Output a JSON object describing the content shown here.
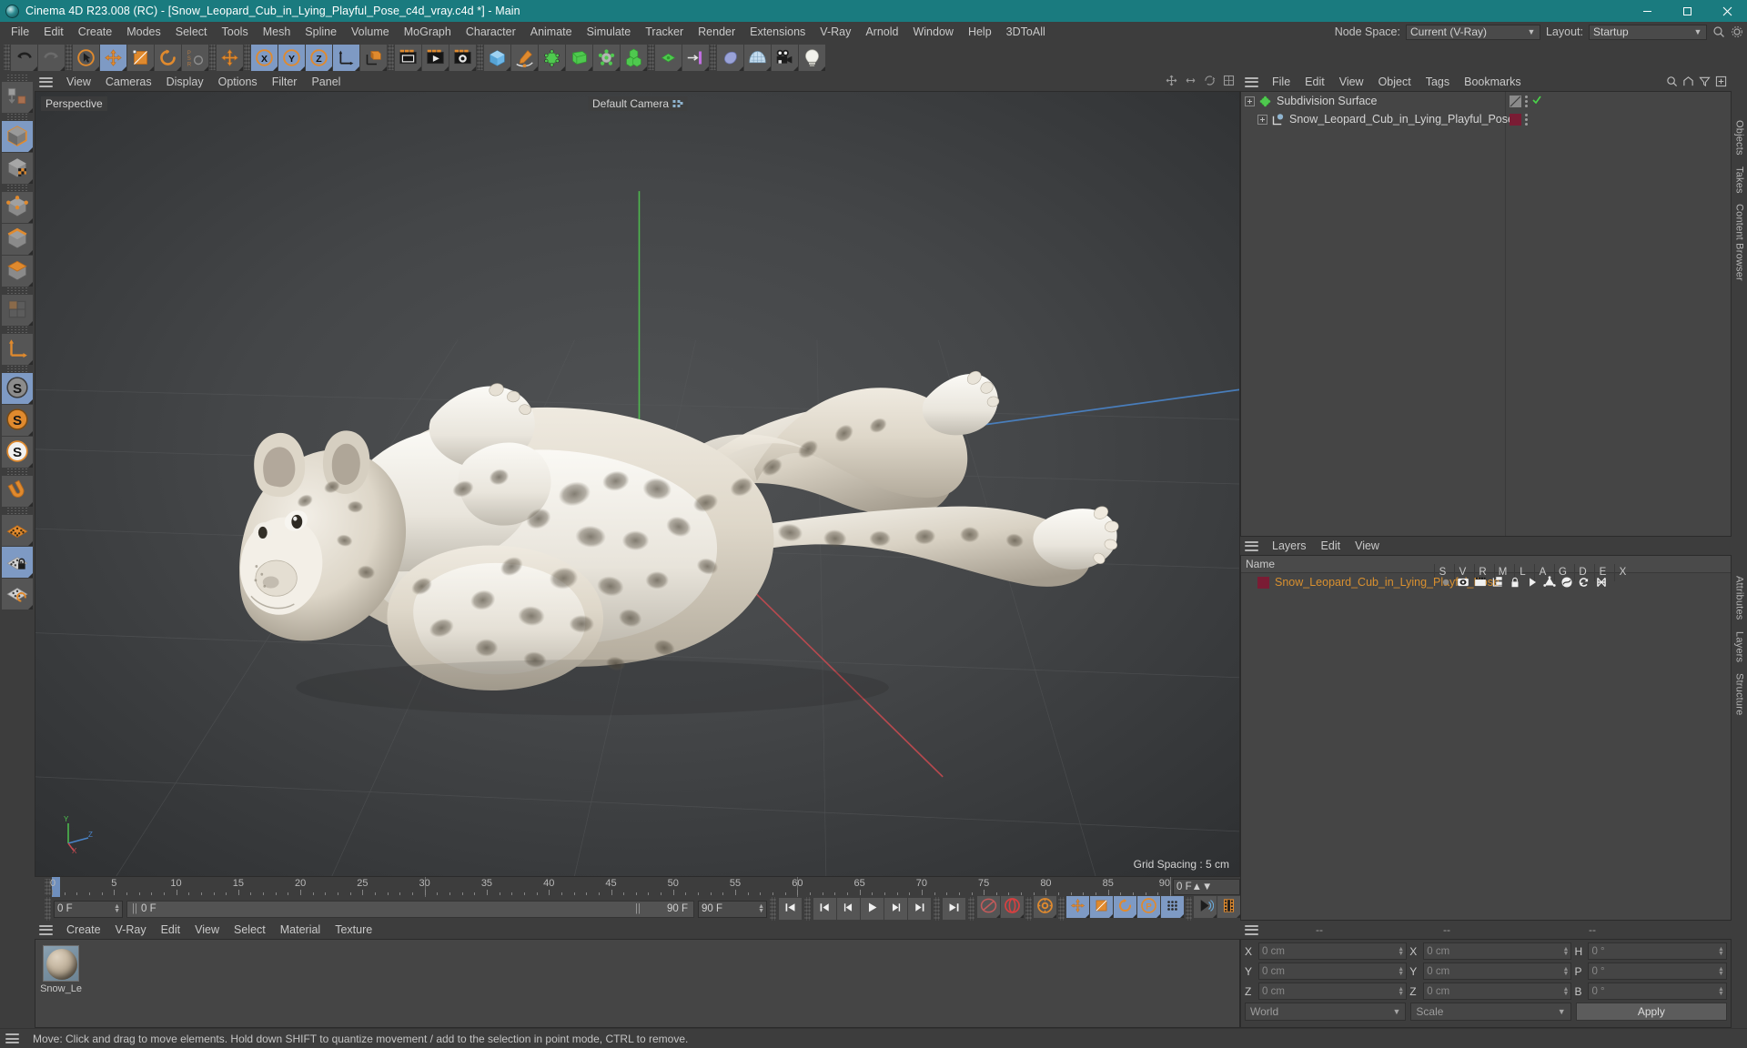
{
  "window": {
    "title": "Cinema 4D R23.008 (RC) - [Snow_Leopard_Cub_in_Lying_Playful_Pose_c4d_vray.c4d *] - Main",
    "minimize_label": "Minimize",
    "maximize_label": "Maximize",
    "close_label": "Close"
  },
  "menubar": {
    "items": [
      "File",
      "Edit",
      "Create",
      "Modes",
      "Select",
      "Tools",
      "Mesh",
      "Spline",
      "Volume",
      "MoGraph",
      "Character",
      "Animate",
      "Simulate",
      "Tracker",
      "Render",
      "Extensions",
      "V-Ray",
      "Arnold",
      "Window",
      "Help",
      "3DToAll"
    ],
    "node_space_label": "Node Space:",
    "node_space_value": "Current (V-Ray)",
    "layout_label": "Layout:",
    "layout_value": "Startup",
    "search_icon": "search-icon",
    "settings_icon": "gear-icon"
  },
  "toolbar": {
    "buttons": [
      {
        "name": "undo",
        "icon": "undo-icon",
        "selected": false
      },
      {
        "name": "redo",
        "icon": "redo-icon",
        "selected": false
      },
      {
        "name": "live-selection",
        "icon": "cursor-circle-icon",
        "selected": false
      },
      {
        "name": "move",
        "icon": "move-arrows-icon",
        "selected": true
      },
      {
        "name": "scale",
        "icon": "scale-box-icon",
        "selected": false
      },
      {
        "name": "rotate",
        "icon": "rotate-circle-icon",
        "selected": false
      },
      {
        "name": "psr-reset",
        "icon": "psr-icon",
        "selected": false
      },
      {
        "name": "move-system",
        "icon": "move-arrows-icon",
        "selected": false
      },
      {
        "name": "lock-x",
        "icon": "axis-x-icon",
        "selected": true
      },
      {
        "name": "lock-y",
        "icon": "axis-y-icon",
        "selected": true
      },
      {
        "name": "lock-z",
        "icon": "axis-z-icon",
        "selected": true
      },
      {
        "name": "world-object-axis",
        "icon": "world-axis-icon",
        "selected": true
      },
      {
        "name": "object-axis",
        "icon": "orange-cube-axis-icon",
        "selected": false
      },
      {
        "name": "render-view",
        "icon": "render-view-icon",
        "selected": false
      },
      {
        "name": "render-to-picture-viewer",
        "icon": "render-picture-icon",
        "selected": false
      },
      {
        "name": "render-settings",
        "icon": "render-settings-icon",
        "selected": false
      },
      {
        "name": "add-cube",
        "icon": "blue-cube-icon",
        "selected": false
      },
      {
        "name": "add-spline",
        "icon": "pen-spline-icon",
        "selected": false
      },
      {
        "name": "add-generator",
        "icon": "green-nurbs-icon",
        "selected": false
      },
      {
        "name": "add-deformer",
        "icon": "green-bend-icon",
        "selected": false
      },
      {
        "name": "add-field",
        "icon": "green-field-icon",
        "selected": false
      },
      {
        "name": "add-array",
        "icon": "green-cubes-icon",
        "selected": false
      },
      {
        "name": "add-mograph",
        "icon": "mograph-icon",
        "selected": false
      },
      {
        "name": "add-tag",
        "icon": "arrow-bar-icon",
        "selected": false
      },
      {
        "name": "add-deformer-2",
        "icon": "blue-deformer-icon",
        "selected": false
      },
      {
        "name": "add-environment",
        "icon": "sky-grid-icon",
        "selected": false
      },
      {
        "name": "add-camera",
        "icon": "camera-icon",
        "selected": false
      },
      {
        "name": "add-light",
        "icon": "light-bulb-icon",
        "selected": false
      }
    ]
  },
  "leftbar": {
    "buttons": [
      {
        "name": "make-editable",
        "icon": "make-editable-icon",
        "selected": false
      },
      {
        "name": "model-mode",
        "icon": "model-cube-icon",
        "selected": true
      },
      {
        "name": "texture-mode",
        "icon": "texture-cube-icon",
        "selected": false
      },
      {
        "name": "point-mode",
        "icon": "point-cube-icon",
        "selected": false
      },
      {
        "name": "edge-mode",
        "icon": "edge-cube-icon",
        "selected": false
      },
      {
        "name": "polygon-mode",
        "icon": "polygon-cube-icon",
        "selected": false
      },
      {
        "name": "uv-mode",
        "icon": "uv-mode-icon",
        "selected": false
      },
      {
        "name": "axis-modify",
        "icon": "axis-modify-icon",
        "selected": false
      },
      {
        "name": "enable-axis",
        "icon": "s-gray-icon",
        "selected": true
      },
      {
        "name": "workplane",
        "icon": "s-orange-icon",
        "selected": false
      },
      {
        "name": "viewport-solo",
        "icon": "s-white-icon",
        "selected": false
      },
      {
        "name": "snap",
        "icon": "magnet-icon",
        "selected": false
      },
      {
        "name": "workplane-grid",
        "icon": "orange-grid-icon",
        "selected": false
      },
      {
        "name": "lock-workplane",
        "icon": "grid-lock-icon",
        "selected": true
      },
      {
        "name": "planar-workplane",
        "icon": "grid-rotate-icon",
        "selected": false
      }
    ]
  },
  "viewport": {
    "menu": [
      "View",
      "Cameras",
      "Display",
      "Options",
      "Filter",
      "Panel"
    ],
    "perspective_label": "Perspective",
    "camera_label": "Default Camera",
    "grid_spacing": "Grid Spacing : 5 cm",
    "axis_x": "X",
    "axis_y": "Y",
    "axis_z": "Z",
    "colors": {
      "x_axis": "#c4454a",
      "y_axis": "#5ec45e",
      "z_axis": "#4a7fc4",
      "background_top": "#4e5052",
      "background_bottom": "#2e3032"
    },
    "subject": "Snow leopard cub 3D model in lying playful pose"
  },
  "timeline": {
    "ticks": [
      0,
      5,
      10,
      15,
      20,
      25,
      30,
      35,
      40,
      45,
      50,
      55,
      60,
      65,
      70,
      75,
      80,
      85,
      90
    ],
    "range_start": 0,
    "range_end": 90,
    "current_frame": "0 F",
    "preview_start": "0 F",
    "preview_end": "90 F",
    "doc_start": "0 F",
    "doc_end": "90 F",
    "end_field": "0 F",
    "transport": [
      {
        "name": "go-to-start",
        "icon": "skip-start-icon"
      },
      {
        "name": "go-to-previous-key",
        "icon": "prev-key-icon"
      },
      {
        "name": "step-back",
        "icon": "step-back-icon"
      },
      {
        "name": "play",
        "icon": "play-icon"
      },
      {
        "name": "step-forward",
        "icon": "step-forward-icon"
      },
      {
        "name": "go-to-next-key",
        "icon": "next-key-icon"
      },
      {
        "name": "go-to-end",
        "icon": "skip-end-icon"
      }
    ],
    "record_tools": [
      {
        "name": "record-active-objects",
        "icon": "record-key-icon",
        "selected": false
      },
      {
        "name": "autokeying",
        "icon": "autokey-icon",
        "selected": false
      },
      {
        "name": "keyframe-selection",
        "icon": "keyframe-gear-icon",
        "selected": false
      },
      {
        "name": "position-key",
        "icon": "pos-key-icon",
        "selected": true
      },
      {
        "name": "scale-key",
        "icon": "scale-key-icon",
        "selected": true
      },
      {
        "name": "rotation-key",
        "icon": "rot-key-icon",
        "selected": true
      },
      {
        "name": "param-key",
        "icon": "param-key-icon",
        "selected": true
      },
      {
        "name": "point-level-animation",
        "icon": "pla-icon",
        "selected": true
      },
      {
        "name": "motion-recording",
        "icon": "motion-record-icon",
        "selected": false
      },
      {
        "name": "timeline-view",
        "icon": "filmstrip-icon",
        "selected": false
      }
    ]
  },
  "material_manager": {
    "menu": [
      "Create",
      "V-Ray",
      "Edit",
      "View",
      "Select",
      "Material",
      "Texture"
    ],
    "materials": [
      {
        "name": "Snow_Le",
        "swatch": "snow-leopard-fur"
      }
    ]
  },
  "object_manager": {
    "menu": [
      "File",
      "Edit",
      "View",
      "Object",
      "Tags",
      "Bookmarks"
    ],
    "header_icons": [
      "search-icon",
      "home-icon",
      "filter-icon",
      "add-panel-icon"
    ],
    "rows": [
      {
        "name": "Subdivision Surface",
        "depth": 0,
        "icon": "subdivision-surface-icon",
        "icon_color": "#37c837",
        "tags": [
          {
            "name": "phong-tag",
            "color": "#8a8a8a"
          },
          {
            "name": "enabled-check",
            "color": "#4ad44a"
          }
        ]
      },
      {
        "name": "Snow_Leopard_Cub_in_Lying_Playful_Pose",
        "depth": 1,
        "icon": "polygon-object-icon",
        "icon_color": "#8fb4cf",
        "tags": [
          {
            "name": "material-tag",
            "color": "#7a1c34"
          }
        ]
      }
    ]
  },
  "layer_manager": {
    "menu": [
      "Layers",
      "Edit",
      "View"
    ],
    "name_column": "Name",
    "columns": [
      "S",
      "V",
      "R",
      "M",
      "L",
      "A",
      "G",
      "D",
      "E",
      "X"
    ],
    "rows": [
      {
        "name": "Snow_Leopard_Cub_in_Lying_Playful_Pose",
        "color": "#7a1c34",
        "text_color": "#d9902f",
        "icons": [
          "solo-dot-icon",
          "eye-icon",
          "render-icon",
          "manager-icon",
          "lock-icon",
          "animation-icon",
          "generator-icon",
          "deformer-icon",
          "expression-icon",
          "xpresso-icon"
        ]
      }
    ]
  },
  "coordinates": {
    "header": [
      "--",
      "--",
      "--"
    ],
    "position": {
      "label_x": "X",
      "label_y": "Y",
      "label_z": "Z",
      "x": "0 cm",
      "y": "0 cm",
      "z": "0 cm"
    },
    "size": {
      "label_x": "X",
      "label_y": "Y",
      "label_z": "Z",
      "x": "0 cm",
      "y": "0 cm",
      "z": "0 cm"
    },
    "rotation": {
      "label_h": "H",
      "label_p": "P",
      "label_b": "B",
      "h": "0 °",
      "p": "0 °",
      "b": "0 °"
    },
    "system": "World",
    "mode": "Scale",
    "apply_label": "Apply"
  },
  "vertical_tabs": {
    "top": [
      "Objects",
      "Takes",
      "Content Browser"
    ],
    "bottom": [
      "Attributes",
      "Layers",
      "Structure"
    ]
  },
  "statusbar": {
    "message": "Move: Click and drag to move elements. Hold down SHIFT to quantize movement / add to the selection in point mode, CTRL to remove."
  }
}
